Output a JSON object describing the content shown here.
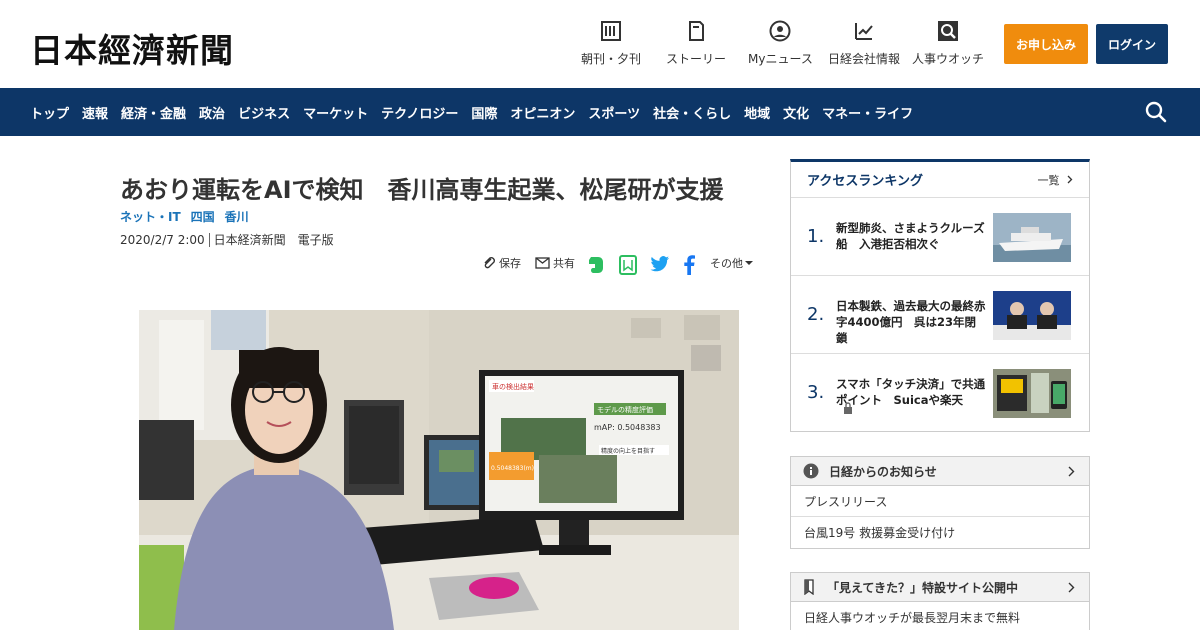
{
  "header": {
    "logo": "日本經濟新聞",
    "nav": [
      {
        "label": "朝刊・夕刊",
        "icon": "newspaper-icon"
      },
      {
        "label": "ストーリー",
        "icon": "book-icon"
      },
      {
        "label": "Myニュース",
        "icon": "user-icon"
      },
      {
        "label": "日経会社情報",
        "icon": "chart-icon"
      },
      {
        "label": "人事ウオッチ",
        "icon": "search-person-icon"
      }
    ],
    "apply_label": "お申し込み",
    "login_label": "ログイン"
  },
  "navbar": {
    "items": [
      "トップ",
      "速報",
      "経済・金融",
      "政治",
      "ビジネス",
      "マーケット",
      "テクノロジー",
      "国際",
      "オピニオン",
      "スポーツ",
      "社会・くらし",
      "地域",
      "文化",
      "マネー・ライフ"
    ]
  },
  "article": {
    "title": "あおり運転をAIで検知　香川高専生起業、松尾研が支援",
    "tags": [
      "ネット・IT",
      "四国",
      "香川"
    ],
    "date": "2020/2/7 2:00",
    "source": "日本経済新聞　電子版",
    "share": {
      "save": "保存",
      "share": "共有",
      "more": "その他"
    }
  },
  "photo": {
    "screen_text": {
      "title": "車の検出結果",
      "model_label": "モデルの精度評価",
      "map_label": "mAP: 0.5048383",
      "left_panel": "0.5048383(m)",
      "bottom_label": "精度の向上を目指す"
    }
  },
  "sidebar": {
    "ranking": {
      "title": "アクセスランキング",
      "more": "一覧",
      "items": [
        {
          "num": "1.",
          "text": "新型肺炎、さまようクルーズ船　入港拒否相次ぐ"
        },
        {
          "num": "2.",
          "text": "日本製鉄、過去最大の最終赤字4400億円　呉は23年閉鎖"
        },
        {
          "num": "3.",
          "text": "スマホ「タッチ決済」で共通ポイント　Suicaや楽天"
        }
      ]
    },
    "notice": {
      "title": "日経からのお知らせ",
      "items": [
        "プレスリリース",
        "台風19号 救援募金受け付け"
      ]
    },
    "special": {
      "title": "「見えてきた？」特設サイト公開中",
      "items": [
        "日経人事ウオッチが最長翌月末まで無料"
      ]
    }
  },
  "colors": {
    "navy": "#0d3667",
    "orange": "#f08c0d",
    "tag_blue": "#1a73b8"
  }
}
